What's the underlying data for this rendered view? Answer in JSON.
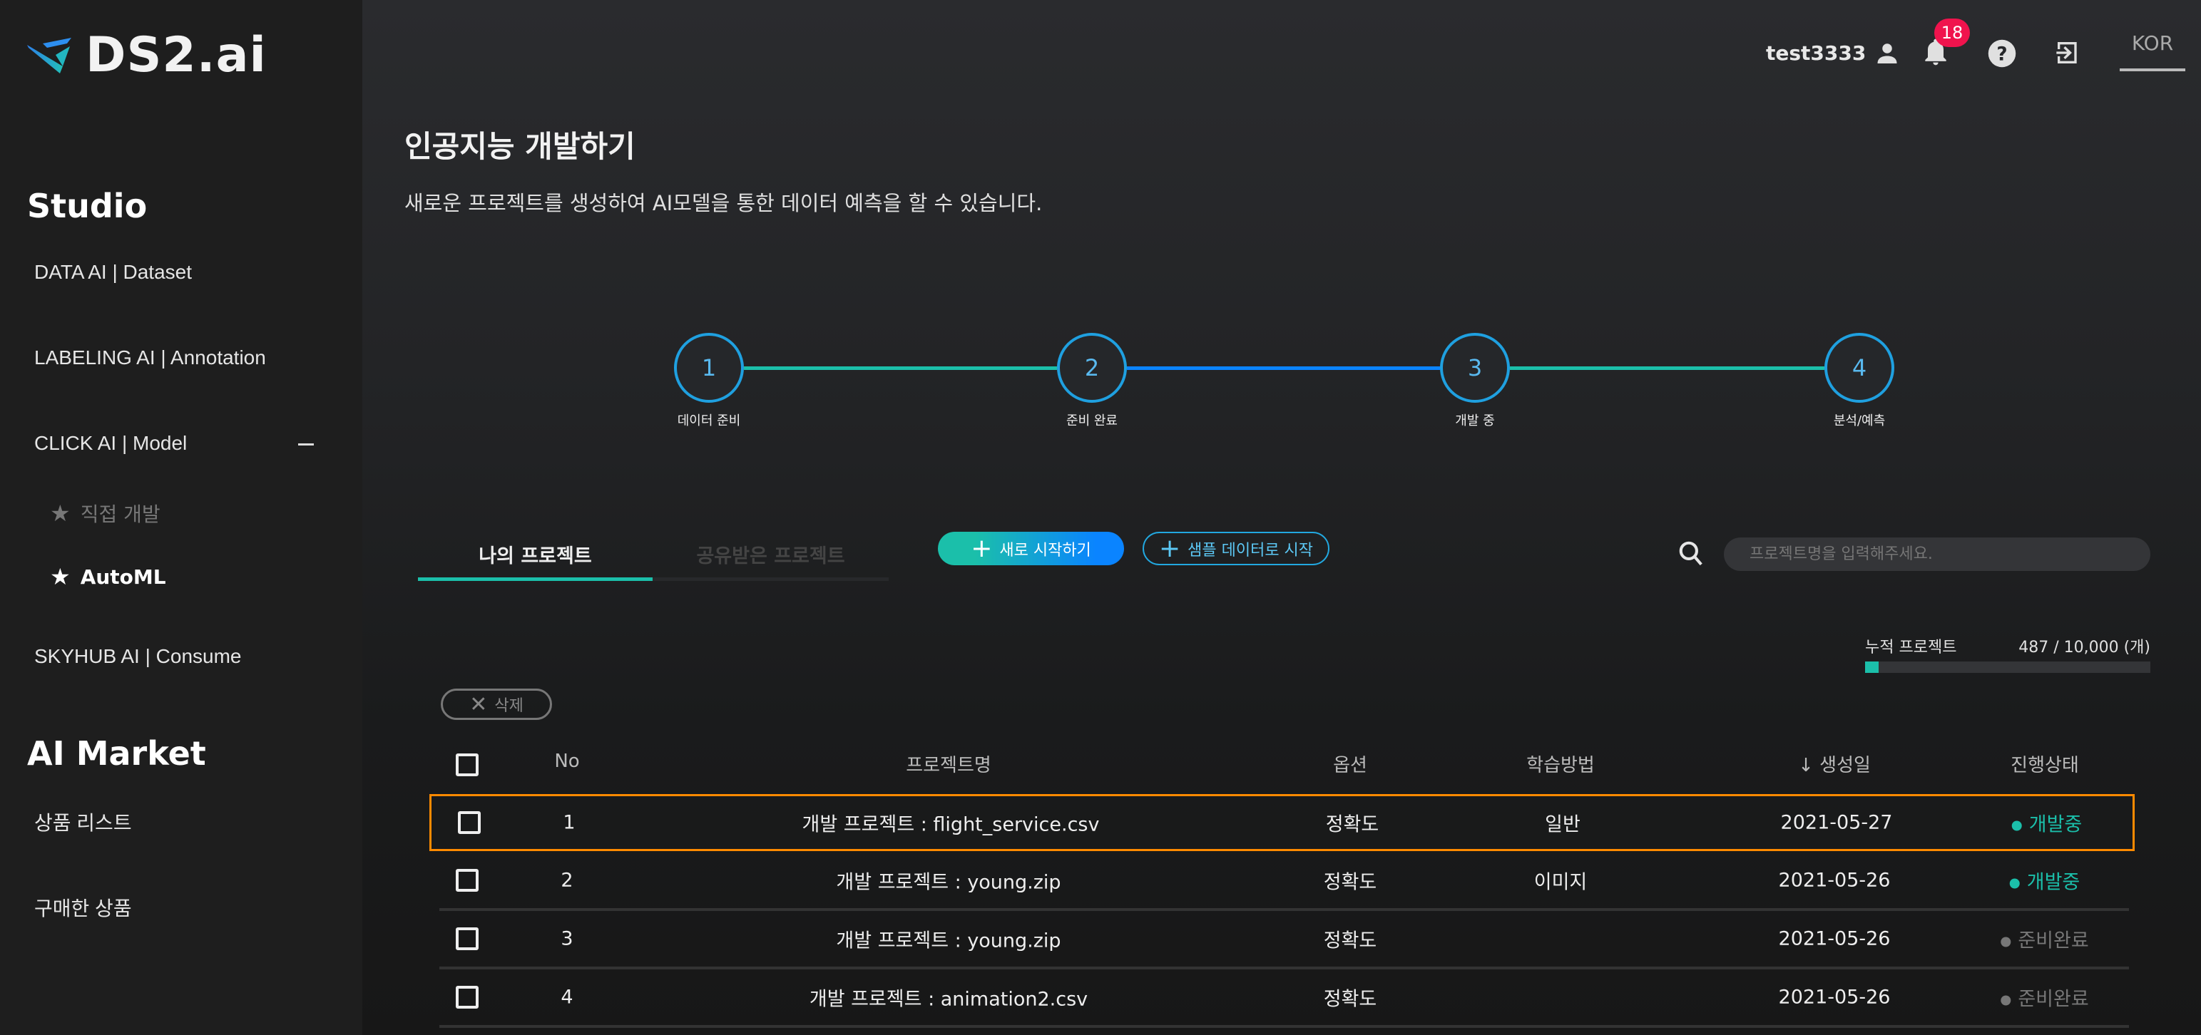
{
  "brand": {
    "name": "DS2.ai"
  },
  "sidebar": {
    "studio_title": "Studio",
    "items": [
      {
        "label": "DATA AI | Dataset"
      },
      {
        "label": "LABELING AI | Annotation"
      },
      {
        "label": "CLICK AI | Model"
      },
      {
        "label": "SKYHUB AI | Consume"
      }
    ],
    "click_sub": [
      {
        "label": "직접 개발",
        "active": false
      },
      {
        "label": "AutoML",
        "active": true
      }
    ],
    "market_title": "AI Market",
    "market_items": [
      {
        "label": "상품 리스트"
      },
      {
        "label": "구매한 상품"
      }
    ]
  },
  "header": {
    "username": "test3333",
    "notification_count": "18",
    "language": "KOR"
  },
  "page": {
    "title": "인공지능 개발하기",
    "subtitle": "새로운 프로젝트를 생성하여 AI모델을 통한 데이터 예측을 할 수 있습니다."
  },
  "steps": [
    {
      "num": "1",
      "label": "데이터 준비"
    },
    {
      "num": "2",
      "label": "준비 완료"
    },
    {
      "num": "3",
      "label": "개발 중"
    },
    {
      "num": "4",
      "label": "분석/예측"
    }
  ],
  "tabs": [
    {
      "label": "나의 프로젝트",
      "active": true
    },
    {
      "label": "공유받은 프로젝트",
      "active": false
    }
  ],
  "buttons": {
    "new_start": "새로 시작하기",
    "sample_start": "샘플 데이터로 시작",
    "delete": "삭제"
  },
  "search": {
    "placeholder": "프로젝트명을 입력해주세요.",
    "value": ""
  },
  "usage": {
    "label": "누적 프로젝트",
    "value": "487 / 10,000 (개)",
    "fraction": 0.0487
  },
  "table": {
    "headers": {
      "no": "No",
      "name": "프로젝트명",
      "option": "옵션",
      "method": "학습방법",
      "date": "생성일",
      "status": "진행상태"
    },
    "rows": [
      {
        "no": "1",
        "name": "개발 프로젝트 : flight_service.csv",
        "option": "정확도",
        "method": "일반",
        "date": "2021-05-27",
        "status": "개발중",
        "status_color": "#1bbfaa",
        "highlighted": true
      },
      {
        "no": "2",
        "name": "개발 프로젝트 : young.zip",
        "option": "정확도",
        "method": "이미지",
        "date": "2021-05-26",
        "status": "개발중",
        "status_color": "#1bbfaa",
        "highlighted": false
      },
      {
        "no": "3",
        "name": "개발 프로젝트 : young.zip",
        "option": "정확도",
        "method": "",
        "date": "2021-05-26",
        "status": "준비완료",
        "status_color": "#777777",
        "highlighted": false
      },
      {
        "no": "4",
        "name": "개발 프로젝트 : animation2.csv",
        "option": "정확도",
        "method": "",
        "date": "2021-05-26",
        "status": "준비완료",
        "status_color": "#777777",
        "highlighted": false
      }
    ]
  },
  "colors": {
    "accent_teal": "#1bbfaa",
    "accent_blue": "#0a84ff",
    "highlight": "#ff8a00",
    "badge": "#f0134d"
  }
}
